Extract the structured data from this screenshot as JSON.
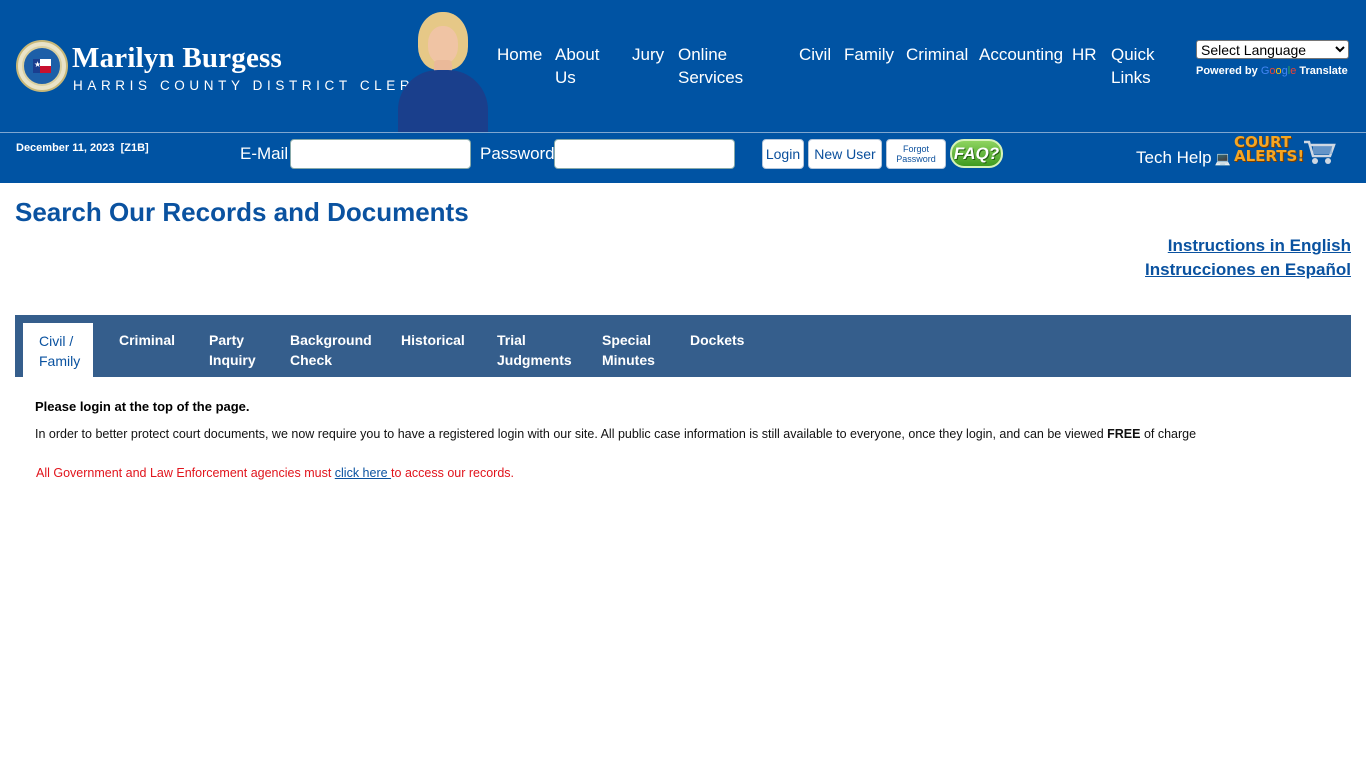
{
  "brand": {
    "name": "Marilyn Burgess",
    "subtitle": "HARRIS COUNTY DISTRICT CLERK"
  },
  "nav": [
    {
      "label": "Home"
    },
    {
      "label": "About Us"
    },
    {
      "label": "Jury"
    },
    {
      "label": "Online Services"
    },
    {
      "label": "Civil"
    },
    {
      "label": "Family"
    },
    {
      "label": "Criminal"
    },
    {
      "label": "Accounting"
    },
    {
      "label": "HR"
    },
    {
      "label": "Quick Links"
    }
  ],
  "translate": {
    "select_label": "Select Language",
    "powered_by": "Powered by",
    "google": [
      "G",
      "o",
      "o",
      "g",
      "l",
      "e"
    ],
    "translate": "Translate"
  },
  "login": {
    "date": "December 11, 2023",
    "code": "[Z1B]",
    "email_label": "E-Mail",
    "password_label": "Password",
    "login_button": "Login",
    "new_user_button": "New User",
    "forgot_line1": "Forgot",
    "forgot_line2": "Password",
    "faq": "FAQ?",
    "tech_help": "Tech Help",
    "alerts_line1": "COURT",
    "alerts_line2": "ALERTS!"
  },
  "main": {
    "title": "Search Our Records and Documents",
    "instructions_en": "Instructions in English",
    "instructions_es": "Instrucciones en Español",
    "tabs": [
      {
        "line1": "Civil /",
        "line2": "Family",
        "active": true
      },
      {
        "line1": "Criminal",
        "line2": "",
        "active": false
      },
      {
        "line1": "Party",
        "line2": "Inquiry",
        "active": false
      },
      {
        "line1": "Background",
        "line2": "Check",
        "active": false
      },
      {
        "line1": "Historical",
        "line2": "",
        "active": false
      },
      {
        "line1": "Trial",
        "line2": "Judgments",
        "active": false
      },
      {
        "line1": "Special",
        "line2": "Minutes",
        "active": false
      },
      {
        "line1": "Dockets",
        "line2": "",
        "active": false
      }
    ],
    "notice_bold": "Please login at the top of the page.",
    "notice_body_prefix": "In order to better protect court documents, we now require you to have a registered login with our site. All public case information is still available to everyone, once they login, and can be viewed ",
    "notice_body_free": "FREE",
    "notice_body_suffix": " of charge",
    "gov_prefix": "All Government and Law Enforcement agencies must ",
    "gov_link": "click here ",
    "gov_suffix": "to access our records."
  },
  "colors": {
    "header_blue": "#0053a3",
    "tab_bar": "#355e8c",
    "title_blue": "#0a52a0",
    "alert_red": "#e1141c"
  }
}
